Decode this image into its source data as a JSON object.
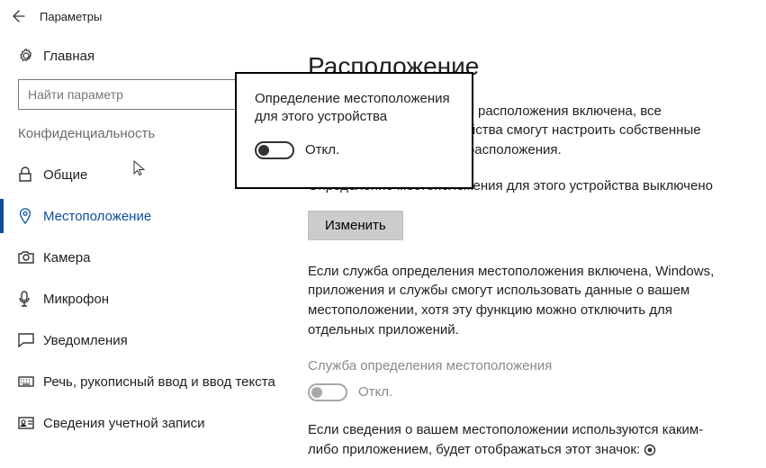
{
  "app_title": "Параметры",
  "home_label": "Главная",
  "search_placeholder": "Найти параметр",
  "section_header": "Конфиденциальность",
  "nav": [
    {
      "label": "Общие"
    },
    {
      "label": "Местоположение"
    },
    {
      "label": "Камера"
    },
    {
      "label": "Микрофон"
    },
    {
      "label": "Уведомления"
    },
    {
      "label": "Речь, рукописный ввод и ввод текста"
    },
    {
      "label": "Сведения учетной записи"
    }
  ],
  "page_title": "Расположение",
  "para1": "Если служба определения расположения включена, все пользователи этого устройства смогут настроить собственные параметры определения расположения.",
  "status_line": "Определение местоположения для этого устройства выключено",
  "change_btn": "Изменить",
  "para2": "Если служба определения местоположения включена, Windows, приложения и службы смогут использовать данные о вашем местоположении, хотя эту функцию можно отключить для отдельных приложений.",
  "service_label": "Служба определения местоположения",
  "toggle_off_text": "Откл.",
  "para3": "Если сведения о вашем местоположении используются каким-либо приложением, будет отображаться этот значок:",
  "popup": {
    "title": "Определение местоположения для этого устройства",
    "toggle_text": "Откл."
  }
}
